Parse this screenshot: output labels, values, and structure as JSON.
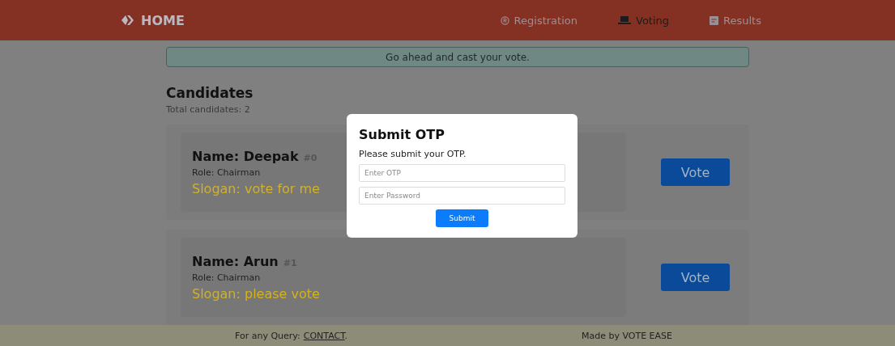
{
  "navbar": {
    "brand": "HOME",
    "links": [
      {
        "label": "Registration",
        "kind": "registration",
        "selected": false
      },
      {
        "label": "Voting",
        "kind": "voting",
        "selected": true
      },
      {
        "label": "Results",
        "kind": "results",
        "selected": false
      }
    ]
  },
  "alert": "Go ahead and cast your vote.",
  "candidates": {
    "title": "Candidates",
    "total": "Total candidates: 2",
    "items": [
      {
        "name": "Name: Deepak",
        "index": "#0",
        "role": "Role: Chairman",
        "slogan": "Slogan: vote for me",
        "button": "Vote"
      },
      {
        "name": "Name: Arun",
        "index": "#1",
        "role": "Role: Chairman",
        "slogan": "Slogan: please vote",
        "button": "Vote"
      }
    ]
  },
  "modal": {
    "title": "Submit OTP",
    "message": "Please submit your OTP.",
    "fields": [
      {
        "placeholder": "Enter OTP"
      },
      {
        "placeholder": "Enter Password"
      }
    ],
    "button": "Submit"
  },
  "footer": {
    "query_label": "For any Query:",
    "contact_link": "CONTACT",
    "period": ".",
    "credit": "Made by VOTE EASE"
  }
}
